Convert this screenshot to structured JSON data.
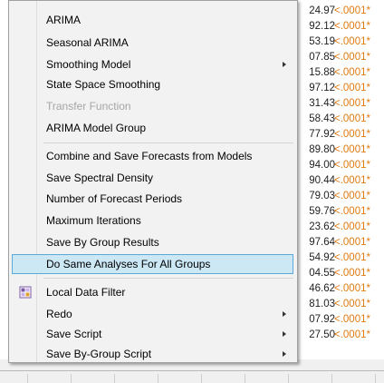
{
  "menu": {
    "items": [
      {
        "label": "ARIMA",
        "submenu": false,
        "disabled": false
      },
      {
        "label": "Seasonal ARIMA",
        "submenu": false,
        "disabled": false
      },
      {
        "label": "Smoothing Model",
        "submenu": true,
        "disabled": false
      },
      {
        "label": "State Space Smoothing",
        "submenu": false,
        "disabled": false
      },
      {
        "label": "Transfer Function",
        "submenu": false,
        "disabled": true
      },
      {
        "label": "ARIMA Model Group",
        "submenu": false,
        "disabled": false
      },
      {
        "label": "Combine and Save Forecasts from Models",
        "submenu": false,
        "disabled": false
      },
      {
        "label": "Save Spectral Density",
        "submenu": false,
        "disabled": false
      },
      {
        "label": "Number of Forecast Periods",
        "submenu": false,
        "disabled": false
      },
      {
        "label": "Maximum Iterations",
        "submenu": false,
        "disabled": false
      },
      {
        "label": "Save By Group Results",
        "submenu": false,
        "disabled": false
      },
      {
        "label": "Do Same Analyses For All Groups",
        "submenu": false,
        "disabled": false,
        "highlighted": true
      },
      {
        "label": "Local Data Filter",
        "submenu": false,
        "disabled": false,
        "icon": "filter-icon"
      },
      {
        "label": "Redo",
        "submenu": true,
        "disabled": false
      },
      {
        "label": "Save Script",
        "submenu": true,
        "disabled": false
      },
      {
        "label": "Save By-Group Script",
        "submenu": true,
        "disabled": false
      }
    ]
  },
  "background_table": {
    "values": [
      "24.97",
      "92.12",
      "53.19",
      "07.85",
      "15.88",
      "97.12",
      "31.43",
      "58.43",
      "77.92",
      "89.80",
      "94.00",
      "90.44",
      "79.03",
      "59.76",
      "23.62",
      "97.64",
      "54.92",
      "04.55",
      "46.62",
      "81.03",
      "07.92",
      "27.50"
    ],
    "pvalue": "<.0001*"
  },
  "colors": {
    "highlight_bg": "#cce8f5",
    "highlight_border": "#5ca8d6",
    "pvalue": "#e07a10",
    "disabled_text": "#a6a6a6"
  }
}
